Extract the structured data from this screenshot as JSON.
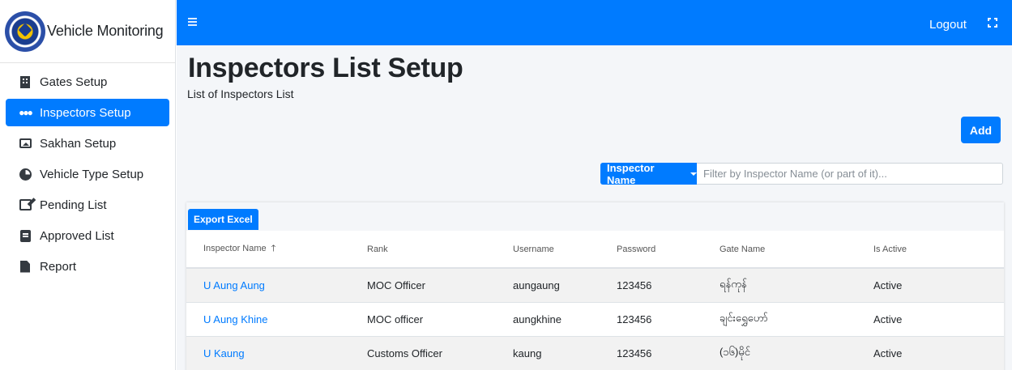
{
  "app": {
    "title": "Vehicle Monitoring"
  },
  "sidebar": {
    "items": [
      {
        "label": "Gates Setup",
        "icon": "building-icon",
        "active": false
      },
      {
        "label": "Inspectors Setup",
        "icon": "users-icon",
        "active": true
      },
      {
        "label": "Sakhan Setup",
        "icon": "image-icon",
        "active": false
      },
      {
        "label": "Vehicle Type Setup",
        "icon": "pie-chart-icon",
        "active": false
      },
      {
        "label": "Pending List",
        "icon": "edit-icon",
        "active": false
      },
      {
        "label": "Approved List",
        "icon": "book-icon",
        "active": false
      },
      {
        "label": "Report",
        "icon": "file-icon",
        "active": false
      }
    ]
  },
  "topbar": {
    "logout_label": "Logout",
    "brand_color": "#007bff"
  },
  "page": {
    "title": "Inspectors List Setup",
    "subtitle": "List of Inspectors List",
    "add_label": "Add"
  },
  "filter": {
    "dropdown_label": "Inspector Name",
    "placeholder": "Filter by Inspector Name (or part of it)..."
  },
  "table": {
    "export_label": "Export Excel",
    "columns": [
      "Inspector Name",
      "Rank",
      "Username",
      "Password",
      "Gate Name",
      "Is Active"
    ],
    "sort_column": "Inspector Name",
    "sort_direction": "ascending",
    "rows": [
      [
        "U Aung Aung",
        "MOC Officer",
        "aungaung",
        "123456",
        "ရန်ကုန်",
        "Active"
      ],
      [
        "U Aung Khine",
        "MOC officer",
        "aungkhine",
        "123456",
        "ချင်းရွှေဟော်",
        "Active"
      ],
      [
        "U Kaung",
        "Customs Officer",
        "kaung",
        "123456",
        "(၁၆)မိုင်",
        "Active"
      ]
    ]
  }
}
